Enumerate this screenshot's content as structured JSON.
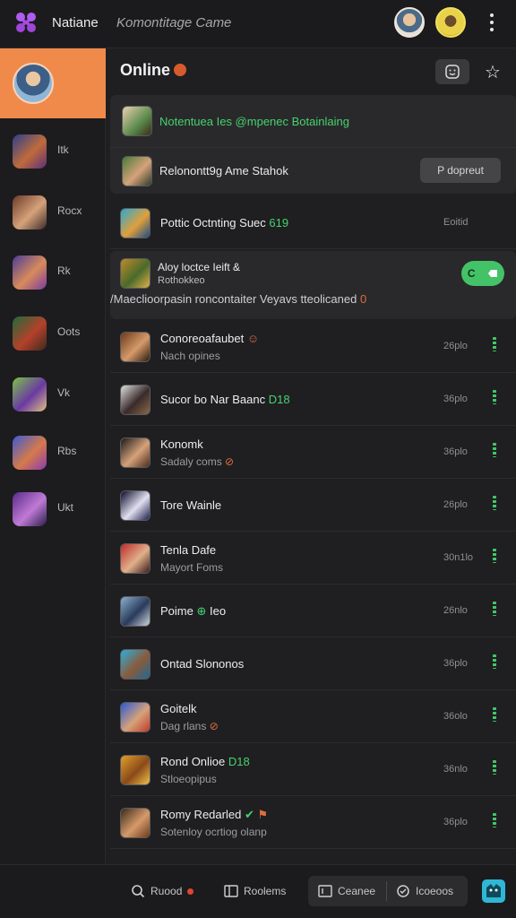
{
  "app": {
    "name": "Natiane",
    "subtitle": "Komontitage Came"
  },
  "colors": {
    "accent": "#f08a4b",
    "online_green": "#45d36e",
    "background": "#1f1f21",
    "panel": "#29292b"
  },
  "rail": {
    "active_icon": "avatar",
    "items": [
      {
        "label": "Itk",
        "icon": "wizard-avatar-icon"
      },
      {
        "label": "Rocx",
        "icon": "warrior-avatar-icon"
      },
      {
        "label": "Rk",
        "icon": "mage-avatar-icon"
      },
      {
        "label": "Oots",
        "icon": "pirate-avatar-icon"
      },
      {
        "label": "Vk",
        "icon": "elf-avatar-icon"
      },
      {
        "label": "Rbs",
        "icon": "witch-avatar-icon"
      },
      {
        "label": "Ukt",
        "icon": "sorcerer-avatar-icon"
      }
    ]
  },
  "main": {
    "title": "Online",
    "featured": {
      "line1": "Notentuea Ies @mpenec Botainlaing",
      "line2": "Relonontt9g Ame Stahok",
      "button": "P dopreut"
    },
    "highlight_row": {
      "name": "Pottic Octnting Suec",
      "tag": "619",
      "time": "Eoitid"
    },
    "notice": {
      "title": "Aloy loctce Ieift &",
      "sub": "Rothokkeo",
      "body": "/Maeclioorpasin roncontaiter Veyavs tteolicaned",
      "toggle_left": "C"
    },
    "rows": [
      {
        "name": "Conoreoafaubet",
        "sub": "Nach opines",
        "time": "26plo"
      },
      {
        "name": "Sucor bo Nar Baanc",
        "tag": "D18",
        "time": "36plo"
      },
      {
        "name": "Konomk",
        "sub": "Sadaly coms",
        "time": "36plo"
      },
      {
        "name": "Tore Wainle",
        "time": "26plo"
      },
      {
        "name": "Tenla Dafe",
        "sub": "Mayort Foms",
        "time": "30n1lo"
      },
      {
        "name": "Poime",
        "tag": "Ieo",
        "time": "26nlo"
      },
      {
        "name": "Ontad Slononos",
        "time": "36plo"
      },
      {
        "name": "Goitelk",
        "sub": "Dag rlans",
        "time": "36olo"
      },
      {
        "name": "Rond Onlioe",
        "tag": "D18",
        "sub": "Stloeopipus",
        "time": "36nlo"
      },
      {
        "name": "Romy Redarled",
        "sub": "Sotenloy ocrtiog olanp",
        "time": "36plo"
      }
    ]
  },
  "bottombar": {
    "item1": "Ruood",
    "item2": "Roolems",
    "item3": "Ceanee",
    "item4": "Icoeoos"
  }
}
